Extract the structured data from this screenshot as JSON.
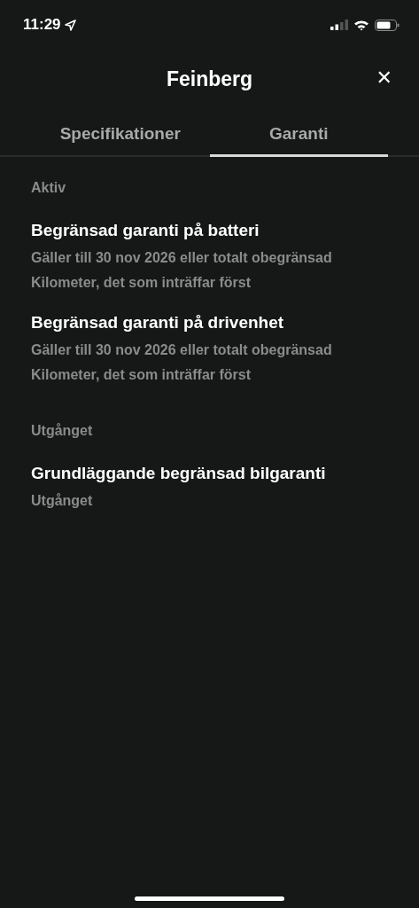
{
  "status_bar": {
    "time": "11:29"
  },
  "header": {
    "title": "Feinberg",
    "close": "✕"
  },
  "tabs": [
    {
      "label": "Specifikationer",
      "selected": false
    },
    {
      "label": "Garanti",
      "selected": true
    }
  ],
  "sections": [
    {
      "heading": "Aktiv",
      "items": [
        {
          "title": "Begränsad garanti på batteri",
          "detail": "Gäller till 30 nov 2026 eller totalt obegränsad Kilometer, det som inträffar först"
        },
        {
          "title": "Begränsad garanti på drivenhet",
          "detail": "Gäller till 30 nov 2026 eller totalt obegränsad Kilometer, det som inträffar först"
        }
      ]
    },
    {
      "heading": "Utgånget",
      "items": [
        {
          "title": "Grundläggande begränsad bilgaranti",
          "detail": "Utgånget"
        }
      ]
    }
  ]
}
